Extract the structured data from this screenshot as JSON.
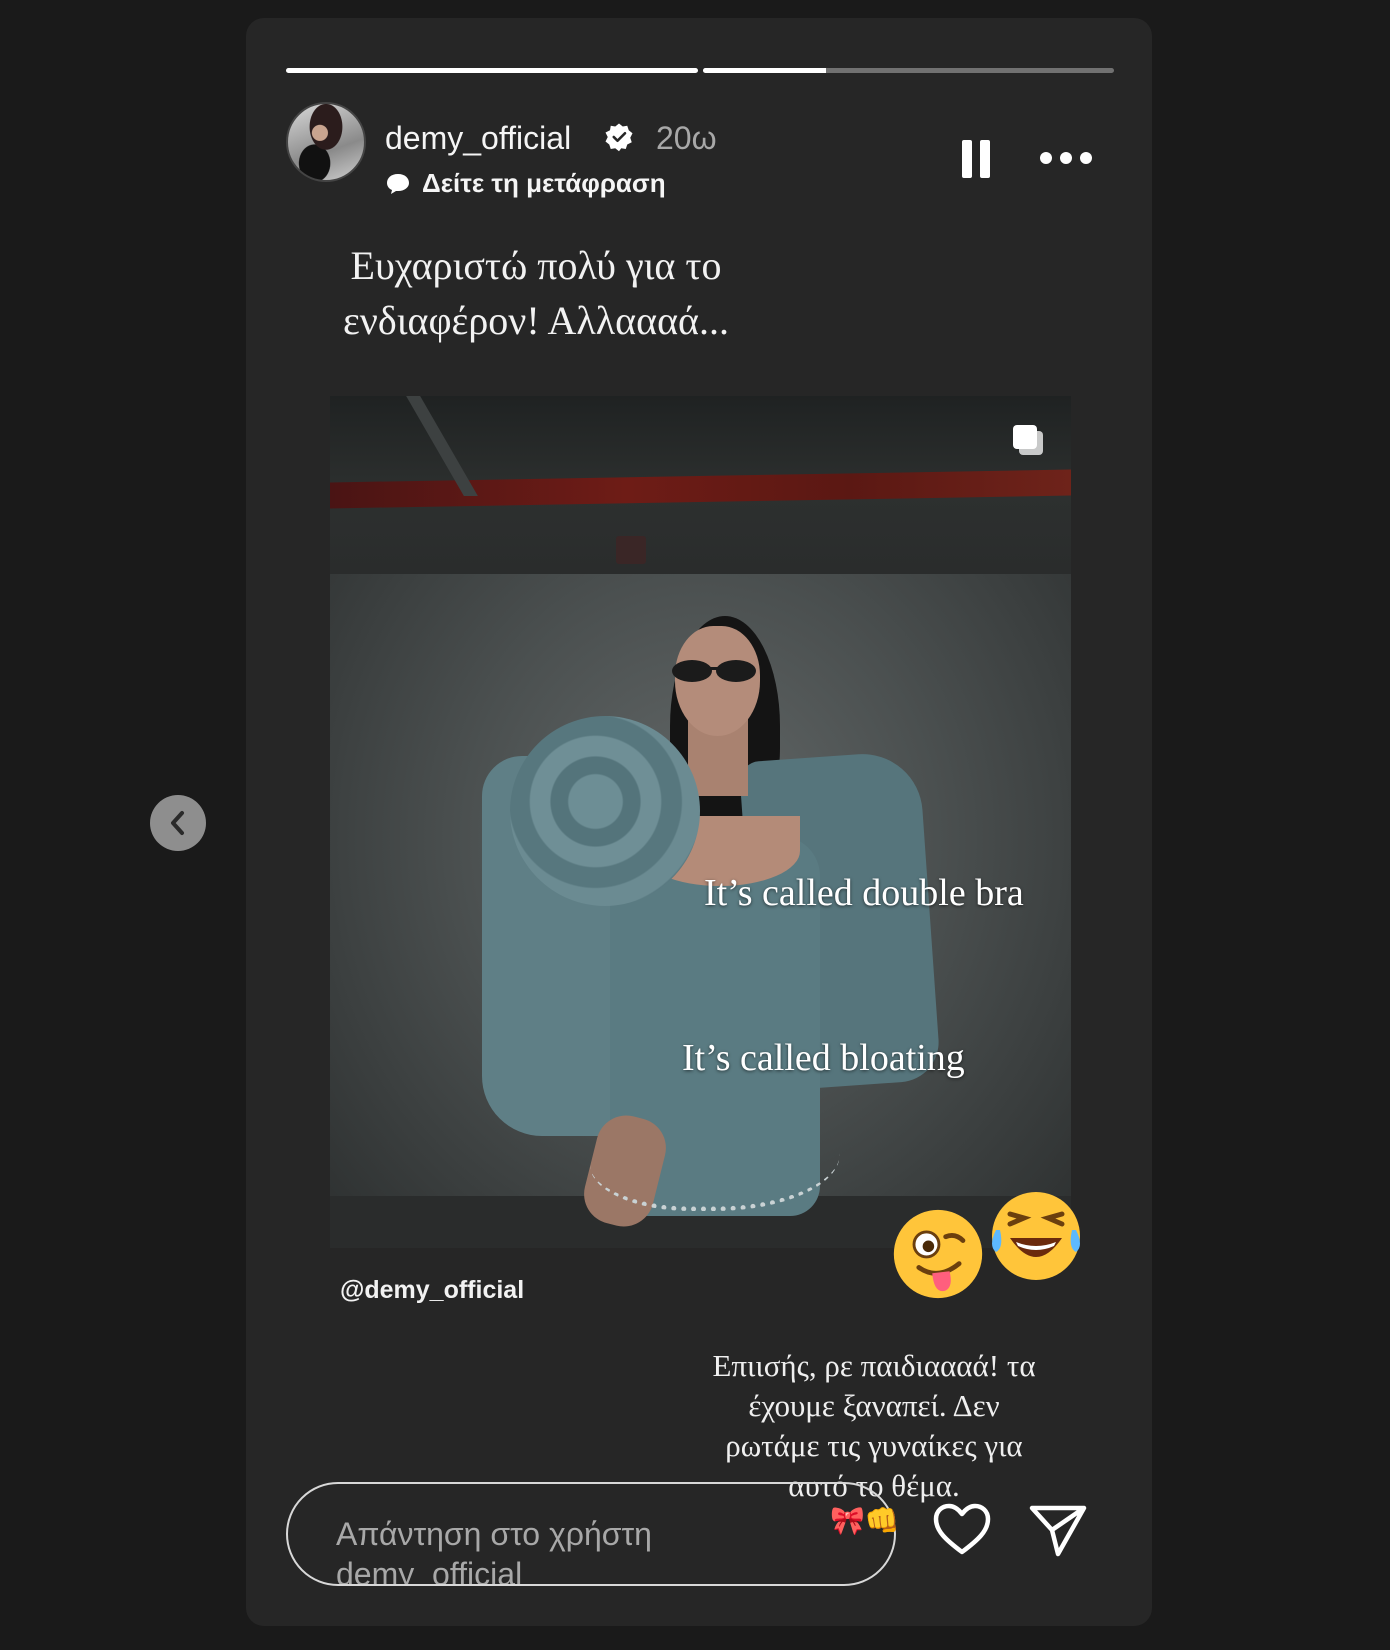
{
  "story": {
    "progress": [
      1.0,
      0.3
    ],
    "username": "demy_official",
    "time": "20ω",
    "translate_label": "Δείτε τη μετάφραση",
    "caption_lines": [
      "Ευχαριστώ πολύ για το",
      "ενδιαφέρον! Αλλαααά..."
    ]
  },
  "post": {
    "overlay_1": "It’s called double bra",
    "overlay_2": "It’s called bloating",
    "mention": "@demy_official"
  },
  "caption2_lines": [
    "Επιισής, ρε παιδιαααά! τα",
    "έχουμε ξαναπεί. Δεν",
    "ρωτάμε τις γυναίκες για",
    "αυτό το θέμα."
  ],
  "reply": {
    "placeholder_lines": [
      "Απάντηση στο χρήστη",
      "demy_official"
    ]
  },
  "icons": {
    "prev": "chevron-left-icon",
    "verified": "verified-badge-icon",
    "pause": "pause-icon",
    "more": "more-icon",
    "heart": "heart-icon",
    "send": "send-icon"
  }
}
